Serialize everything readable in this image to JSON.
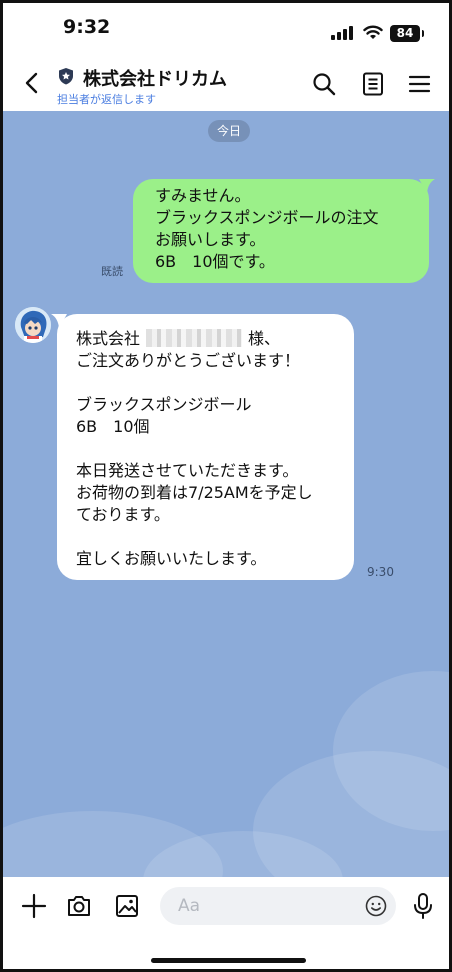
{
  "status_bar": {
    "time": "9:32",
    "battery": "84"
  },
  "header": {
    "title": "株式会社ドリカム",
    "subtitle": "担当者が返信します",
    "icons": [
      "back-icon",
      "shield-icon",
      "search-icon",
      "notes-icon",
      "menu-icon"
    ]
  },
  "chat": {
    "date_label": "今日",
    "outgoing": {
      "lines": [
        "すみません。",
        "ブラックスポンジボールの注文",
        "お願いします。",
        "6B　10個です。"
      ],
      "read_label": "既読"
    },
    "incoming": {
      "line1_prefix": "株式会社",
      "line1_suffix": "様、",
      "lines": [
        "ご注文ありがとうございます！",
        "",
        "ブラックスポンジボール",
        "6B　10個",
        "",
        "本日発送させていただきます。",
        "お荷物の到着は7/25AMを予定し",
        "ております。",
        "",
        "宜しくお願いいたします。"
      ],
      "time": "9:30"
    }
  },
  "input_bar": {
    "placeholder": "Aa",
    "icons": [
      "plus-icon",
      "camera-icon",
      "image-icon",
      "emoji-icon",
      "microphone-icon"
    ]
  },
  "colors": {
    "chat_background": "#8cabd9",
    "outgoing_bubble": "#9bf089",
    "incoming_bubble": "#ffffff",
    "subtitle": "#4a7de0"
  }
}
